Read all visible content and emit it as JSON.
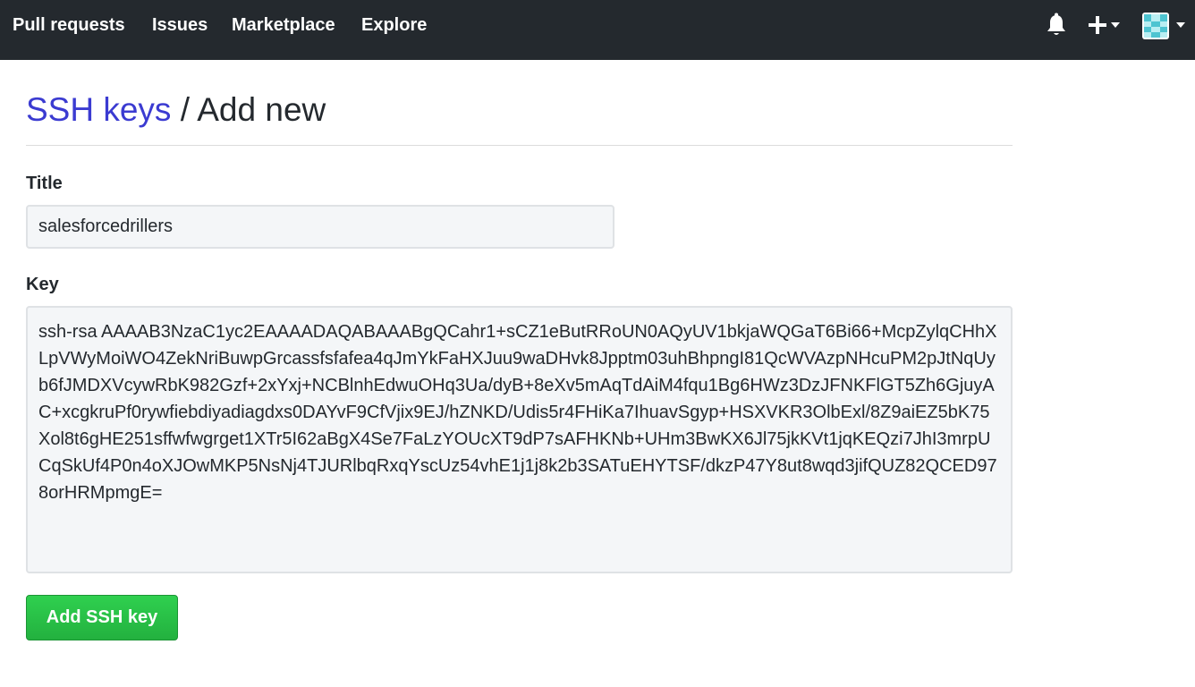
{
  "nav": {
    "items": [
      {
        "label": "Pull requests"
      },
      {
        "label": "Issues"
      },
      {
        "label": "Marketplace"
      },
      {
        "label": "Explore"
      }
    ],
    "right_icons": [
      "bell-icon",
      "plus-icon",
      "avatar"
    ]
  },
  "header": {
    "breadcrumb_link": "SSH keys",
    "separator": "/",
    "current": "Add new"
  },
  "form": {
    "title_label": "Title",
    "title_value": "salesforcedrillers",
    "key_label": "Key",
    "key_value": "ssh-rsa AAAAB3NzaC1yc2EAAAADAQABAAABgQCahr1+sCZ1eButRRoUN0AQyUV1bkjaWQGaT6Bi66+McpZylqCHhXLpVWyMoiWO4ZekNriBuwpGrcassfsfafea4qJmYkFaHXJuu9waDHvk8Jpptm03uhBhpngI81QcWVAzpNHcuPM2pJtNqUyb6fJMDXVcywRbK982Gzf+2xYxj+NCBlnhEdwuOHq3Ua/dyB+8eXv5mAqTdAiM4fqu1Bg6HWz3DzJFNKFlGT5Zh6GjuyAC+xcgkruPf0rywfiebdiyadiagdxs0DAYvF9CfVjix9EJ/hZNKD/Udis5r4FHiKa7IhuavSgyp+HSXVKR3OlbExl/8Z9aiEZ5bK75Xol8t6gHE251sffwfwgrget1XTr5I62aBgX4Se7FaLzYOUcXT9dP7sAFHKNb+UHm3BwKX6Jl75jkKVt1jqKEQzi7JhI3mrpUCqSkUf4P0n4oXJOwMKP5NsNj4TJURlbqRxqYscUz54vhE1j1j8k2b3SATuEHYTSF/dkzP47Y8ut8wqd3jifQUZ82QCED978orHRMpmgE=",
    "submit_label": "Add SSH key"
  },
  "colors": {
    "nav_bg": "#24292e",
    "link": "#3b3bd1",
    "button_green": "#28be46",
    "input_bg": "#f4f6f8"
  }
}
